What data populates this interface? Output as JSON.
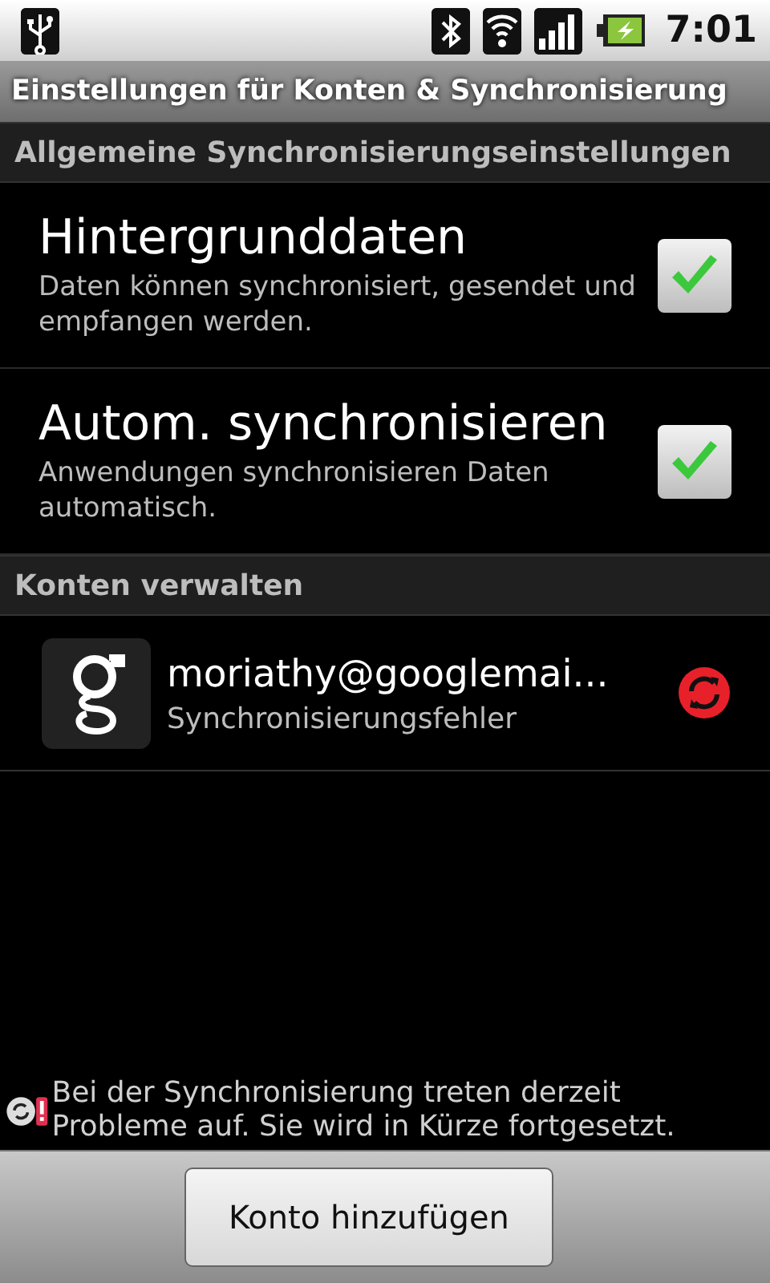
{
  "status_bar": {
    "time": "7:01"
  },
  "title_bar": {
    "title": "Einstellungen für Konten & Synchronisierung"
  },
  "general_section": {
    "header": "Allgemeine Synchronisierungseinstellungen",
    "settings": [
      {
        "title": "Hintergrunddaten",
        "summary": "Daten können synchronisiert, gesendet und empfangen werden.",
        "checked": true
      },
      {
        "title": "Autom. synchronisieren",
        "summary": "Anwendungen synchronisieren Daten automatisch.",
        "checked": true
      }
    ]
  },
  "accounts_section": {
    "header": "Konten verwalten",
    "accounts": [
      {
        "name": "moriathy@googlemai...",
        "status": "Synchronisierungsfehler"
      }
    ]
  },
  "warning": {
    "text": "Bei der Synchronisierung treten derzeit Probleme auf. Sie wird in Kürze fortgesetzt."
  },
  "bottom_bar": {
    "button": "Konto hinzufügen"
  }
}
